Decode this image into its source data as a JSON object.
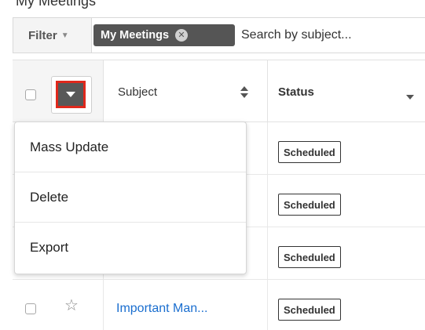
{
  "top_text": "My Meetings",
  "filter": {
    "button_label": "Filter",
    "active_filter": "My Meetings",
    "search_placeholder": "Search by subject..."
  },
  "table": {
    "columns": [
      "Subject",
      "Status"
    ],
    "rows": [
      {
        "subject": "",
        "status": "Scheduled"
      },
      {
        "subject": "",
        "status": "Scheduled"
      },
      {
        "subject": "",
        "status": "Scheduled"
      },
      {
        "subject": "Important Man...",
        "status": "Scheduled"
      }
    ]
  },
  "actions_menu": {
    "items": [
      "Mass Update",
      "Delete",
      "Export"
    ]
  },
  "colors": {
    "highlight_border": "#e0281c",
    "link": "#1a6ecf",
    "pill_bg": "#555555"
  },
  "icons": {
    "filter_caret": "chevron-down-icon",
    "pill_remove": "close-circle-icon",
    "actions_toggle": "caret-down-icon",
    "subject_sort": "sort-icon",
    "status_menu": "chevron-down-icon",
    "favorite": "star-icon"
  }
}
